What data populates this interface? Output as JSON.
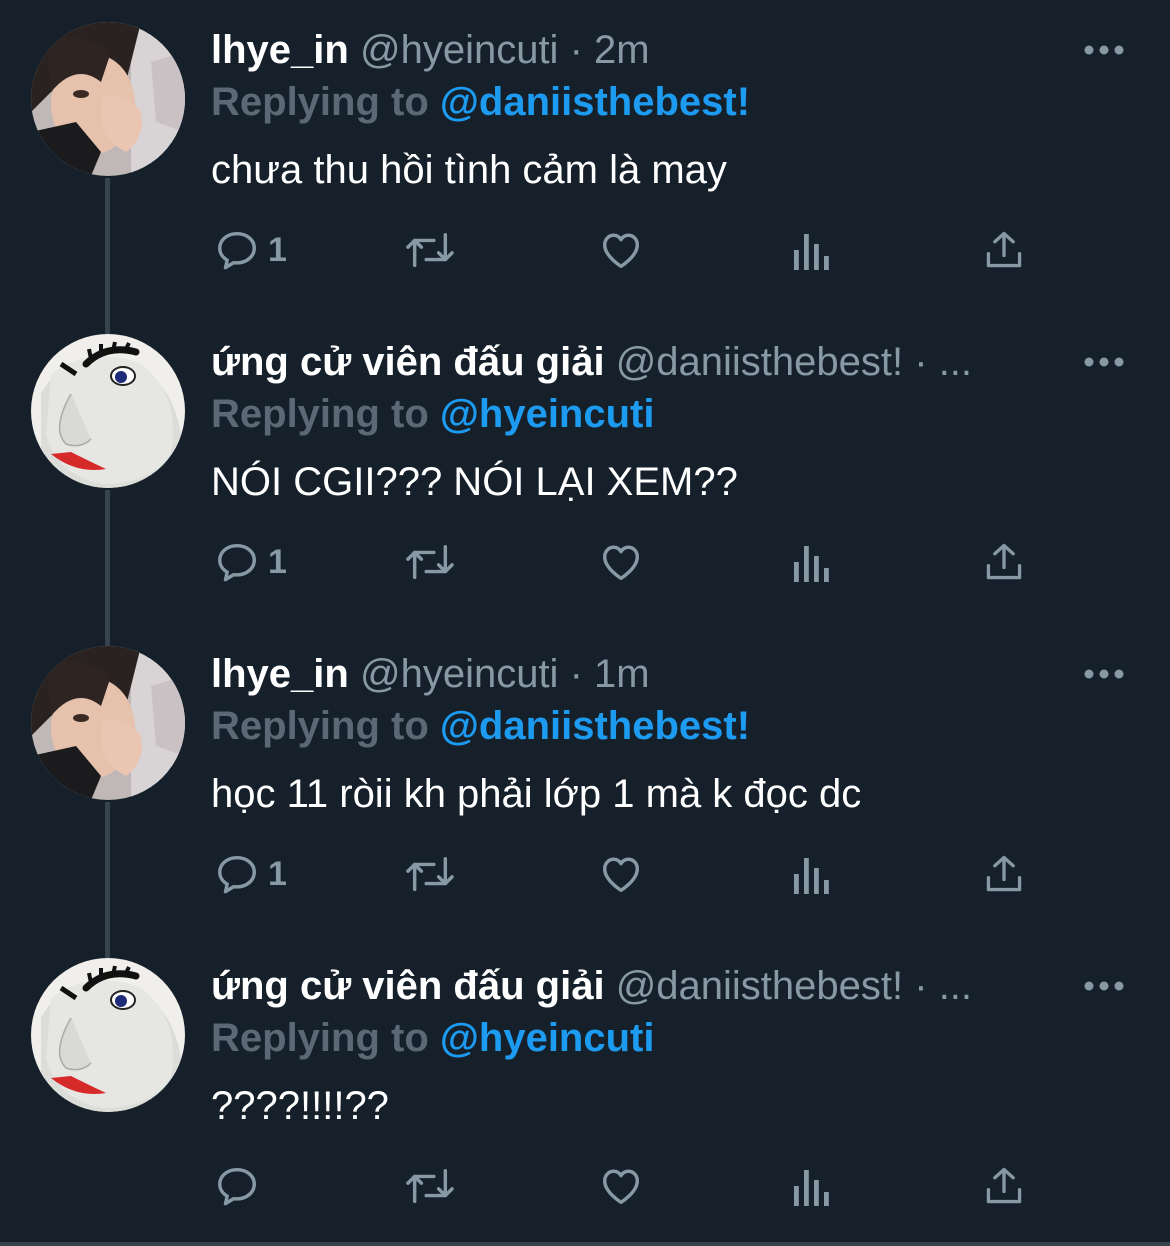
{
  "tweets": [
    {
      "display_name": "lhye_in",
      "handle": "@hyeincuti",
      "time": " · 2m",
      "replying_prefix": "Replying to ",
      "replying_to": "@daniisthebest!",
      "text": "chưa thu hồi tình cảm là may",
      "reply_count": "1",
      "avatar": "photo-avatar"
    },
    {
      "display_name": "ứng cử viên đấu giải",
      "handle": "@daniisthebest!",
      "time": " · ...",
      "replying_prefix": "Replying to ",
      "replying_to": "@hyeincuti",
      "text": "NÓI CGII??? NÓI LẠI XEM??",
      "reply_count": "1",
      "avatar": "cartoon-face-avatar"
    },
    {
      "display_name": "lhye_in",
      "handle": "@hyeincuti",
      "time": " · 1m",
      "replying_prefix": "Replying to ",
      "replying_to": "@daniisthebest!",
      "text": "học 11 ròii kh phải lớp 1 mà k đọc dc",
      "reply_count": "1",
      "avatar": "photo-avatar"
    },
    {
      "display_name": "ứng cử viên đấu giải",
      "handle": "@daniisthebest!",
      "time": " · ...",
      "replying_prefix": "Replying to ",
      "replying_to": "@hyeincuti",
      "text": "????!!!!??",
      "reply_count": "",
      "avatar": "cartoon-face-avatar"
    }
  ],
  "colors": {
    "background": "#15202b",
    "secondary_text": "#8899a6",
    "mention": "#1d9bf0",
    "divider": "#38444d"
  },
  "icons": [
    "reply-icon",
    "retweet-icon",
    "like-icon",
    "analytics-icon",
    "share-icon",
    "more-icon"
  ]
}
